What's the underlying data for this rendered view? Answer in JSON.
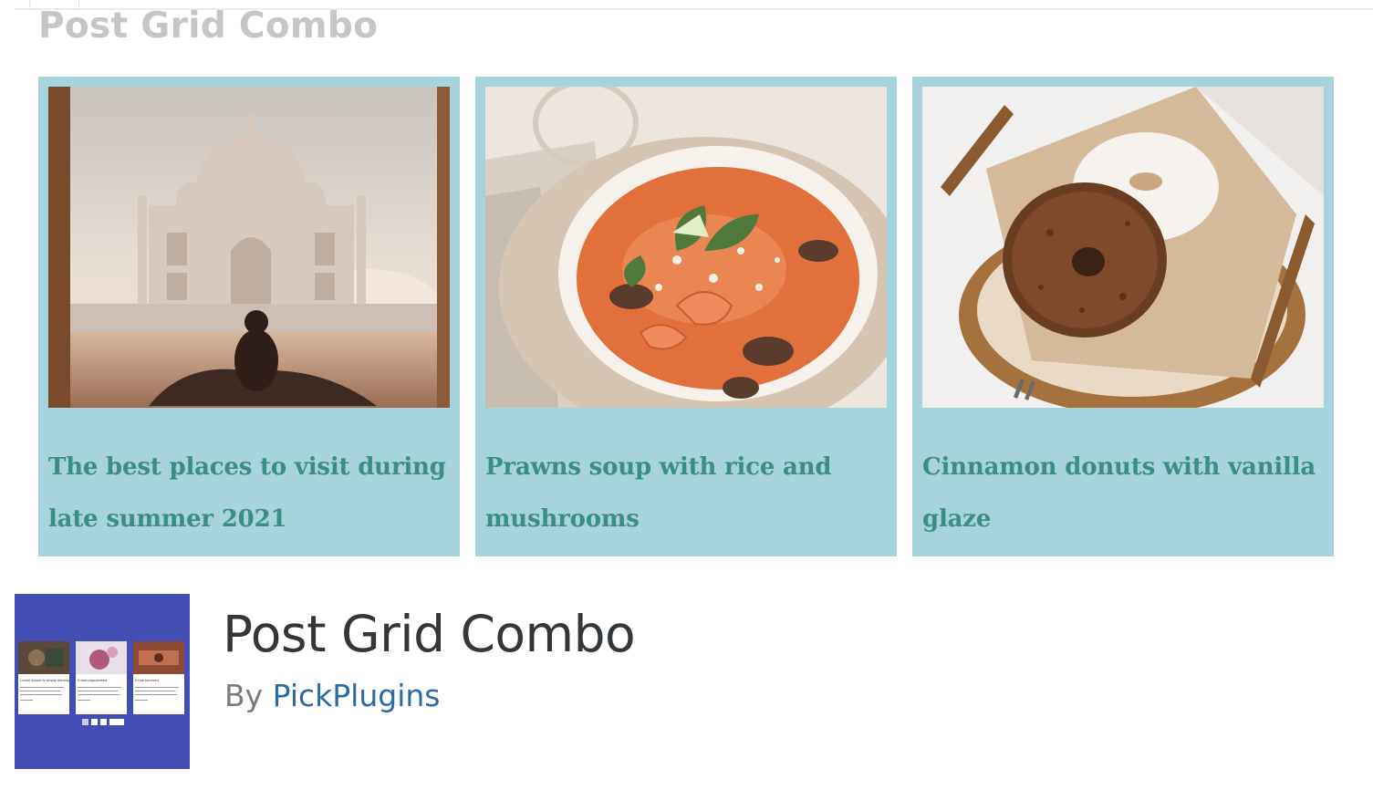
{
  "banner": {
    "title": "Post Grid Combo",
    "cards": [
      {
        "title": "The best places to visit during late summer 2021",
        "image": "taj-mahal-photo"
      },
      {
        "title": "Prawns soup with rice and mushrooms",
        "image": "prawn-soup-photo"
      },
      {
        "title": "Cinnamon donuts with vanilla glaze",
        "image": "donuts-basket-photo"
      }
    ]
  },
  "plugin": {
    "name": "Post Grid Combo",
    "by_label": "By",
    "author": "PickPlugins",
    "icon": {
      "name": "post-grid-combo-logo",
      "card_titles": [
        "Lorem Ipsum is simply dummy",
        "It was popularised",
        "It has survived"
      ]
    }
  },
  "colors": {
    "card_background": "#a7d3dd",
    "card_title": "#3b8d86",
    "banner_title": "#c6c6c6",
    "plugin_icon_bg": "#434db3",
    "plugin_name": "#32373c",
    "author_link": "#2c6aa3",
    "byline": "#787c82"
  }
}
